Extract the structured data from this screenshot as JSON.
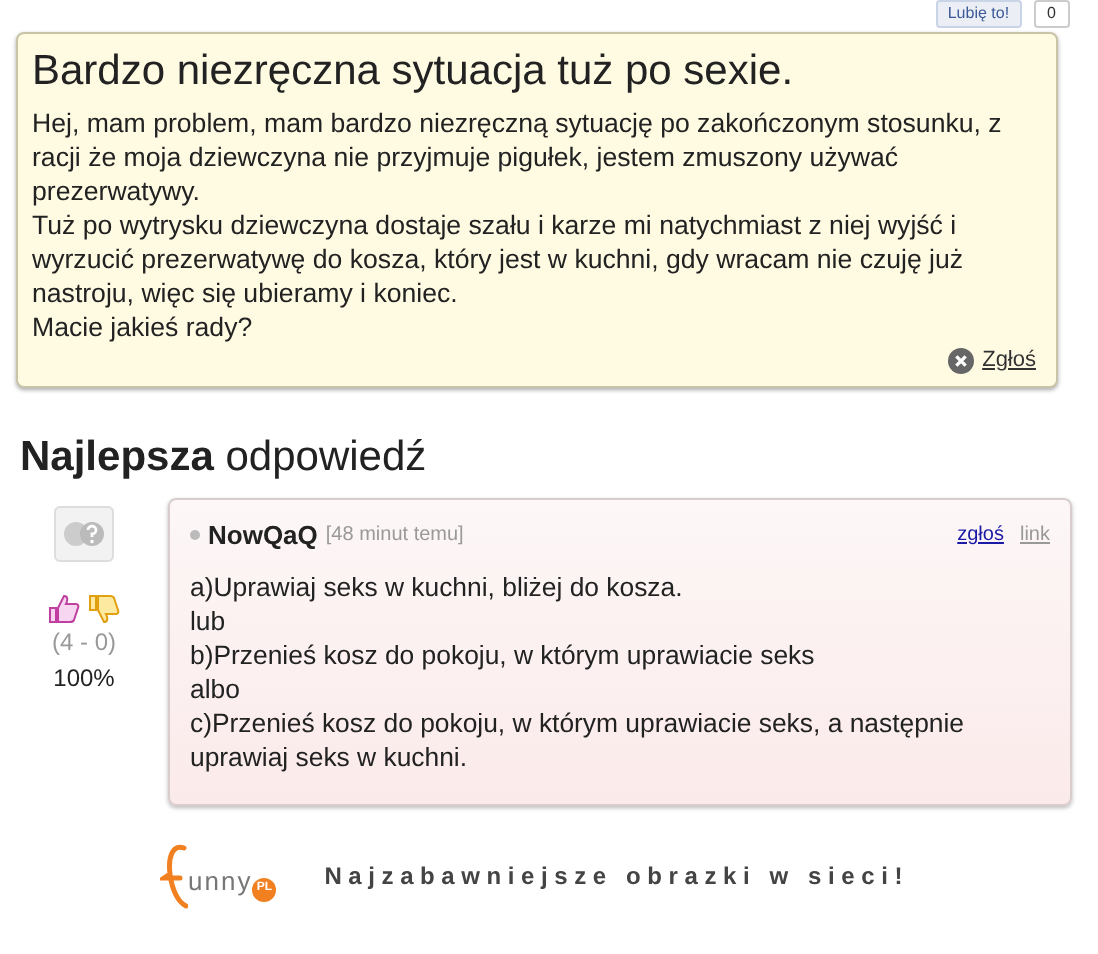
{
  "top_bar": {
    "like_button": "Lubię to!",
    "like_count": "0"
  },
  "question": {
    "title": "Bardzo niezręczna sytuacja tuż po sexie.",
    "paragraphs": [
      "Hej, mam problem, mam bardzo niezręczną sytuację po zakończonym stosunku, z racji że moja dziewczyna nie przyjmuje pigułek, jestem zmuszony używać prezerwatywy.",
      "Tuż po wytrysku dziewczyna dostaje szału i karze mi natychmiast z niej wyjść i wyrzucić prezerwatywę do kosza, który jest w kuchni, gdy wracam nie czuję już nastroju, więc się ubieramy i koniec.",
      "Macie jakieś rady?"
    ],
    "report": "Zgłoś"
  },
  "best_answer": {
    "heading": "**Najlepsza** odpowiedź",
    "votes": "(4 - 0)",
    "percent": "100%",
    "author": "NowQaQ",
    "time": "[48 minut temu]",
    "actions": [
      "zgłoś",
      "link"
    ],
    "lines": [
      "a)Uprawiaj seks w kuchni, bliżej do kosza.",
      "lub",
      "b)Przenieś kosz do pokoju, w którym uprawiacie seks",
      "albo",
      "c)Przenieś kosz do pokoju, w którym uprawiacie seks, a następnie uprawiaj seks w kuchni."
    ]
  },
  "footer": {
    "logo": "unny",
    "logo_badge": "PL",
    "tagline": "Najzabawniejsze obrazki w sieci!"
  }
}
